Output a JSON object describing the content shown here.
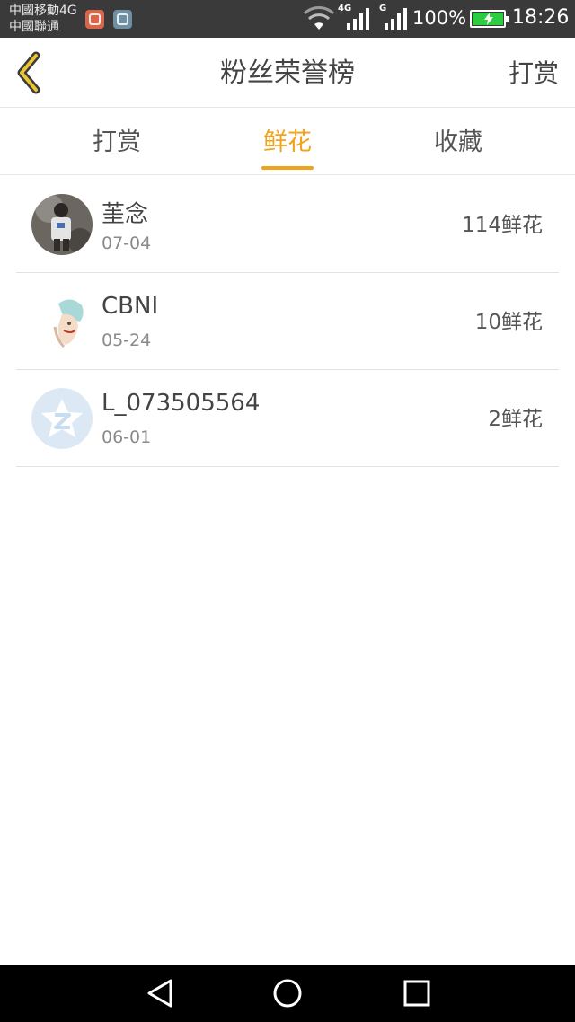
{
  "status_bar": {
    "carrier_1": "中國移動4G",
    "carrier_2": "中國聯通",
    "net_1": "4G",
    "net_2": "G",
    "battery_percent": "100%",
    "battery_level": 1.0,
    "time": "18:26",
    "battery_color": "#2ecc40"
  },
  "header": {
    "back_icon": "chevron-left-icon",
    "title": "粉丝荣誉榜",
    "action_label": "打赏",
    "accent_color": "#e0b21c"
  },
  "tabs": [
    {
      "label": "打赏",
      "active": false
    },
    {
      "label": "鲜花",
      "active": true
    },
    {
      "label": "收藏",
      "active": false
    }
  ],
  "active_tab_color": "#f0a21a",
  "fans": [
    {
      "name": "茥念",
      "date": "07-04",
      "amount": "114鲜花"
    },
    {
      "name": "CBNI",
      "date": "05-24",
      "amount": "10鲜花"
    },
    {
      "name": "L_073505564",
      "date": "06-01",
      "amount": "2鲜花"
    }
  ],
  "nav_bar": {
    "back_icon": "triangle-back-icon",
    "home_icon": "circle-home-icon",
    "recent_icon": "square-recents-icon"
  }
}
